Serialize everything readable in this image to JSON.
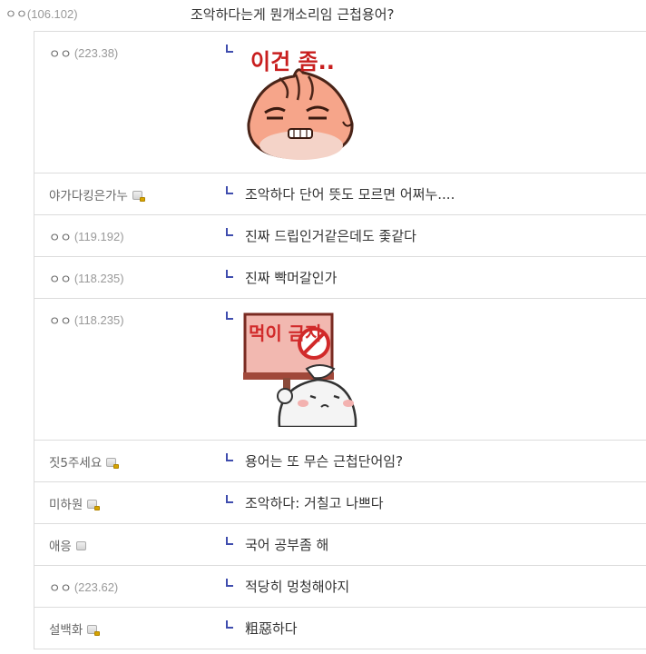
{
  "post": {
    "author": "ㅇㅇ",
    "ip": "(106.102)",
    "text": "조악하다는게 뭔개소리임 근첩용어?"
  },
  "replies": [
    {
      "author": "ㅇㅇ",
      "ip": "(223.38)",
      "text": "",
      "sticker": "dumpling-sticker",
      "sticker_caption": "이건 좀.."
    },
    {
      "author": "야가다킹은가누",
      "ip": "",
      "text": "조악하다 단어 뜻도 모르면 어쩌누....",
      "badge": "fixed-nick-badge"
    },
    {
      "author": "ㅇㅇ",
      "ip": "(119.192)",
      "text": "진짜 드립인거같은데도 좇같다"
    },
    {
      "author": "ㅇㅇ",
      "ip": "(118.235)",
      "text": "진짜 빡머갈인가"
    },
    {
      "author": "ㅇㅇ",
      "ip": "(118.235)",
      "text": "",
      "sticker": "no-eating-sticker",
      "sticker_caption": "먹이 금지"
    },
    {
      "author": "짓5주세요",
      "ip": "",
      "text": "용어는 또 무슨 근첩단어임?",
      "badge": "fixed-nick-badge"
    },
    {
      "author": "미하원",
      "ip": "",
      "text": "조악하다: 거칠고 나쁘다",
      "badge": "fixed-nick-badge"
    },
    {
      "author": "애응",
      "ip": "",
      "text": "국어 공부좀 해",
      "badge": "half-nick-badge"
    },
    {
      "author": "ㅇㅇ",
      "ip": "(223.62)",
      "text": "적당히 멍청해야지"
    },
    {
      "author": "설백화",
      "ip": "",
      "text": "粗惡하다",
      "badge": "fixed-nick-badge"
    }
  ],
  "colors": {
    "reply_mark": "#3f4dae",
    "border": "#dcdcdc"
  }
}
